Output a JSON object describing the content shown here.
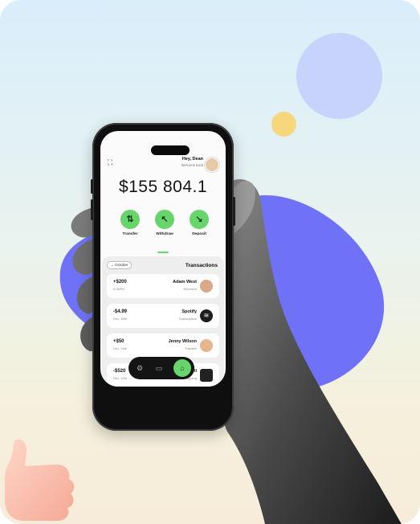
{
  "header": {
    "greeting": "Hey, Dean",
    "subtitle": "Welcome back"
  },
  "balance": "$155 804.1",
  "actions": [
    {
      "label": "Deposit",
      "icon": "arrow-down-right-icon"
    },
    {
      "label": "Withdraw",
      "icon": "arrow-up-left-icon"
    },
    {
      "label": "Transfer",
      "icon": "swap-vertical-icon"
    }
  ],
  "transactions": {
    "title": "Transactions",
    "month": "October",
    "items": [
      {
        "name": "Adam West",
        "category": "Received",
        "amount": "+$200",
        "date": "6:35PM"
      },
      {
        "name": "Spotify",
        "category": "Subscription",
        "amount": "-$4.99",
        "date": "Dec, 15th"
      },
      {
        "name": "Jenny Wilson",
        "category": "Transfer",
        "amount": "+$50",
        "date": "Dec, 13th"
      },
      {
        "name": "Dell",
        "category": "Shopping",
        "amount": "-$520",
        "date": "Dec, 12th"
      }
    ]
  },
  "colors": {
    "accent": "#67d56b",
    "purple": "#6f72f6",
    "phone": "#0f0f10"
  }
}
